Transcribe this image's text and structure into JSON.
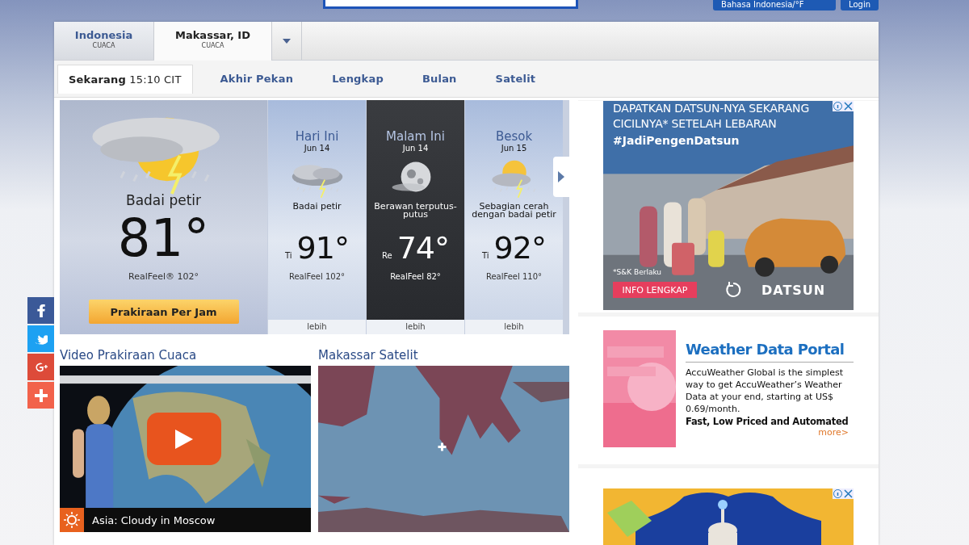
{
  "header": {
    "language": "Bahasa Indonesia/°F",
    "login": "Login"
  },
  "location_tabs": [
    {
      "label": "Indonesia",
      "sub": "CUACA",
      "selected": false
    },
    {
      "label": "Makassar, ID",
      "sub": "CUACA",
      "selected": true
    }
  ],
  "sub_tabs": [
    {
      "label": "Sekarang",
      "time": "15:10 CIT",
      "selected": true
    },
    {
      "label": "Akhir Pekan",
      "selected": false
    },
    {
      "label": "Lengkap",
      "selected": false
    },
    {
      "label": "Bulan",
      "selected": false
    },
    {
      "label": "Satelit",
      "selected": false
    }
  ],
  "current": {
    "condition": "Badai petir",
    "temp": "81°",
    "realfeel": "RealFeel® 102°",
    "button": "Prakiraan Per Jam"
  },
  "forecast": [
    {
      "kind": "day",
      "title": "Hari Ini",
      "date": "Jun 14",
      "condition": "Badai petir",
      "hl": "Ti",
      "temp": "91°",
      "realfeel": "RealFeel 102°",
      "more": "lebih"
    },
    {
      "kind": "night",
      "title": "Malam Ini",
      "date": "Jun 14",
      "condition": "Berawan terputus-putus",
      "hl": "Re",
      "temp": "74°",
      "realfeel": "RealFeel 82°",
      "more": "lebih"
    },
    {
      "kind": "day",
      "title": "Besok",
      "date": "Jun 15",
      "condition": "Sebagian cerah dengan badai petir",
      "hl": "Ti",
      "temp": "92°",
      "realfeel": "RealFeel 110°",
      "more": "lebih"
    }
  ],
  "video": {
    "title": "Video Prakiraan Cuaca",
    "caption": "Asia: Cloudy in Moscow"
  },
  "satellite": {
    "title": "Makassar Satelit"
  },
  "ads": [
    {
      "kind": "banner",
      "headline_1": "DAPATKAN DATSUN-NYA SEKARANG",
      "headline_2": "CICILNYA* SETELAH LEBARAN",
      "hashtag": "#JadiPengenDatsun",
      "note": "*S&K Berlaku",
      "button": "INFO LENGKAP",
      "brand": "DATSUN"
    },
    {
      "kind": "text",
      "title": "Weather Data Portal",
      "body": "AccuWeather Global is the simplest way to get AccuWeather’s Weather Data at your end, starting at US$ 0.69/month.",
      "tagline": "Fast, Low Priced and Automated",
      "link": "more>"
    },
    {
      "kind": "festive"
    }
  ],
  "social": [
    {
      "kind": "facebook",
      "color": "#3b5998"
    },
    {
      "kind": "twitter",
      "color": "#1da1f2"
    },
    {
      "kind": "google",
      "color": "#dd4b39"
    },
    {
      "kind": "share",
      "color": "#f2624b"
    }
  ]
}
